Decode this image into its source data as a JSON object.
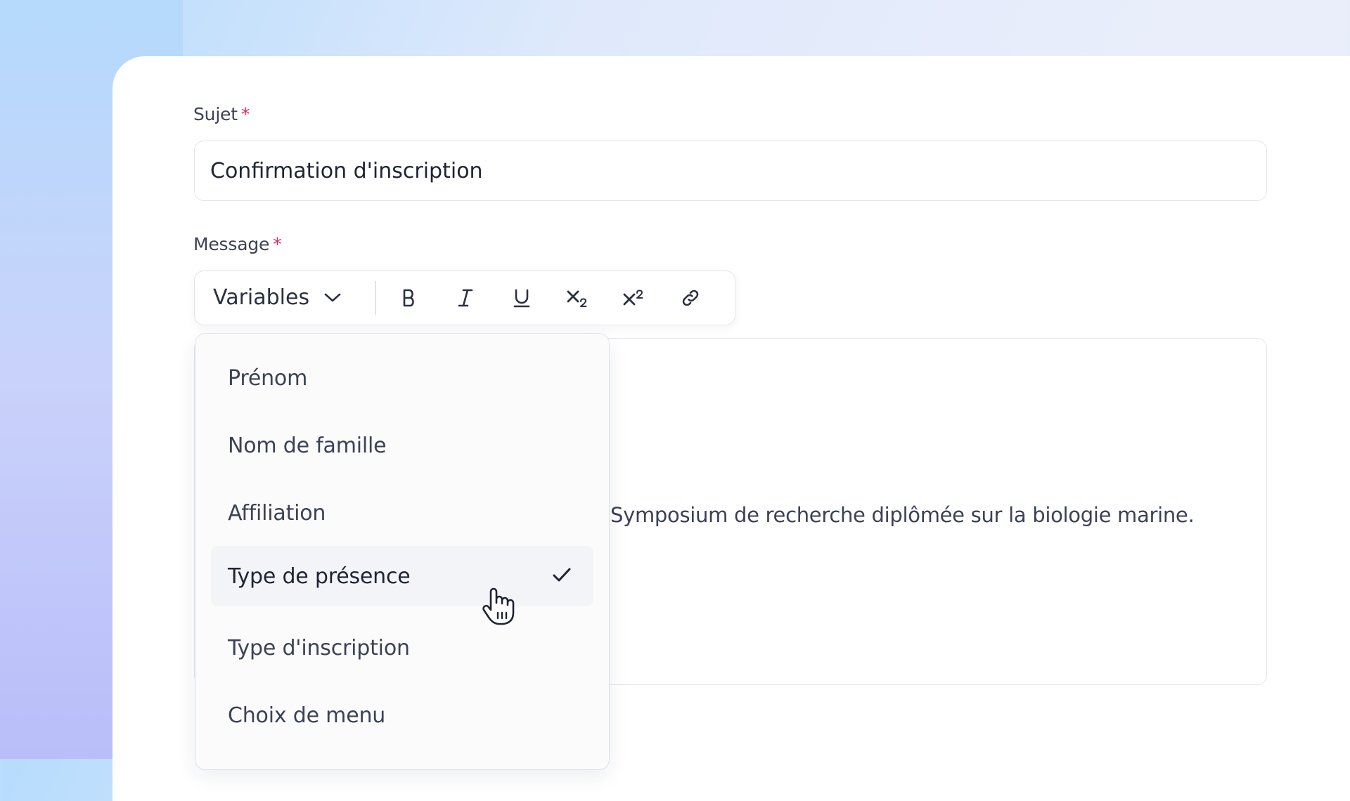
{
  "form": {
    "subject_label": "Sujet",
    "subject_required": "*",
    "subject_value": "Confirmation d'inscription",
    "message_label": "Message",
    "message_required": "*",
    "message_text": "Symposium de recherche diplômée sur la biologie marine."
  },
  "toolbar": {
    "variables_label": "Variables",
    "tools": [
      {
        "name": "bold",
        "icon": "bold-icon"
      },
      {
        "name": "italic",
        "icon": "italic-icon"
      },
      {
        "name": "underline",
        "icon": "underline-icon"
      },
      {
        "name": "subscript",
        "icon": "subscript-icon"
      },
      {
        "name": "superscript",
        "icon": "superscript-icon"
      },
      {
        "name": "link",
        "icon": "link-icon"
      }
    ]
  },
  "dropdown": {
    "items": [
      {
        "label": "Prénom",
        "selected": false
      },
      {
        "label": "Nom de famille",
        "selected": false
      },
      {
        "label": "Affiliation",
        "selected": false
      },
      {
        "label": "Type de présence",
        "selected": true
      },
      {
        "label": "Type d'inscription",
        "selected": false
      },
      {
        "label": "Choix de menu",
        "selected": false
      }
    ]
  },
  "colors": {
    "required": "#e0245e",
    "text": "#3b4256",
    "border": "#e2e4ea"
  }
}
